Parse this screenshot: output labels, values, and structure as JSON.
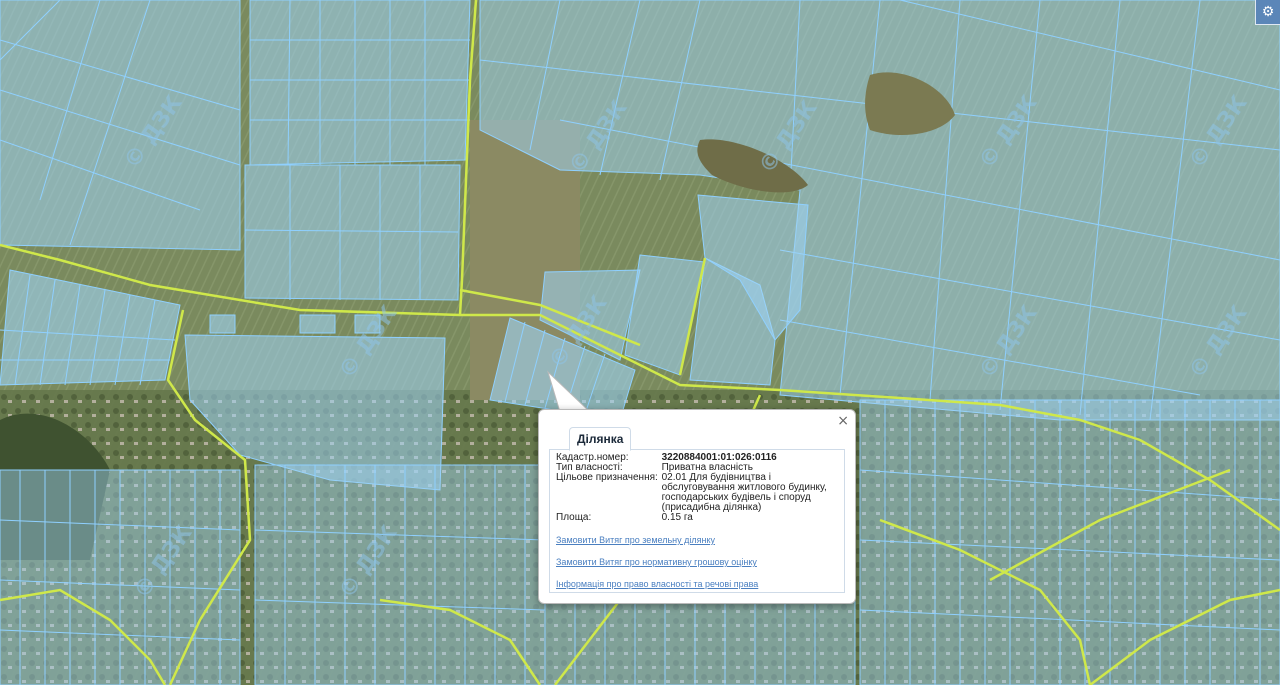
{
  "map": {
    "watermark": "© ДЗК",
    "colors": {
      "parcel_fill": "#9fd3f5",
      "parcel_stroke": "#8fd0ff",
      "boundary": "#cfe84a",
      "field": "#7e8f63",
      "field_dark": "#5f6f48",
      "road": "#9a9670"
    }
  },
  "controls": {
    "settings_icon": "gear-icon"
  },
  "popup": {
    "tab_label": "Ділянка",
    "close_symbol": "×",
    "fields": [
      {
        "key": "Кадастр.номер:",
        "value": "3220884001:01:026:0116"
      },
      {
        "key": "Тип власності:",
        "value": "Приватна власність"
      },
      {
        "key": "Цільове призначення:",
        "value": "02.01 Для будівництва і обслуговування житлового будинку, господарських будівель і споруд (присадибна ділянка)"
      },
      {
        "key": "Площа:",
        "value": "0.15 га"
      }
    ],
    "links": [
      "Замовити Витяг про земельну ділянку",
      "Замовити Витяг про нормативну грошову оцінку",
      "Інформація про право власності та речові права"
    ]
  }
}
